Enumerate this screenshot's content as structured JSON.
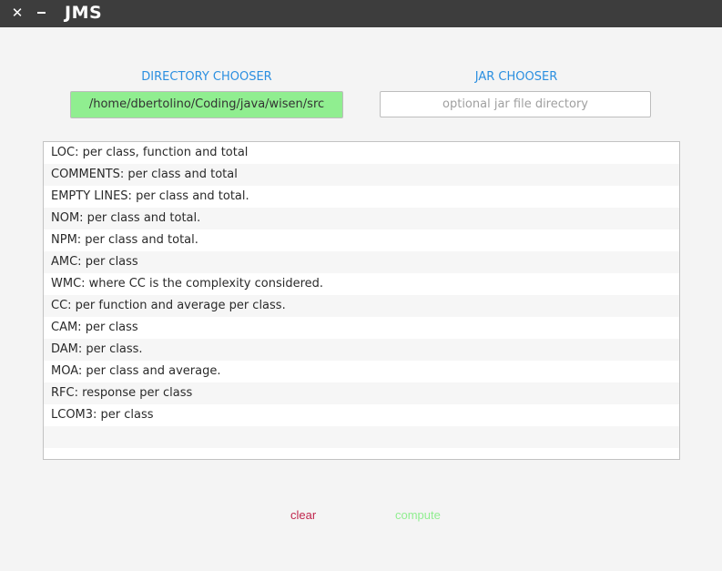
{
  "titlebar": {
    "title": "JMS",
    "close_glyph": "✕",
    "close_icon": "close-icon",
    "minimize_icon": "minimize-icon"
  },
  "directory_chooser": {
    "label": "DIRECTORY CHOOSER",
    "value": "/home/dbertolino/Coding/java/wisen/src",
    "background_color": "#90ee90"
  },
  "jar_chooser": {
    "label": "JAR CHOOSER",
    "placeholder": "optional jar file directory",
    "value": ""
  },
  "metrics_list": {
    "items": [
      "LOC: per class, function and total",
      "COMMENTS: per class and total",
      "EMPTY LINES: per class and total.",
      "NOM: per class and total.",
      "NPM: per class and total.",
      "AMC: per class",
      "WMC: where CC is the complexity considered.",
      "CC: per function and average per class.",
      "CAM: per class",
      "DAM: per class.",
      "MOA: per class and average.",
      "RFC: response per class",
      "LCOM3: per class"
    ]
  },
  "actions": {
    "clear_label": "clear",
    "compute_label": "compute"
  },
  "colors": {
    "accent_blue": "#2b8fe0",
    "clear_red": "#c0264d",
    "compute_green": "#90ee90",
    "titlebar_bg": "#3d3d3d"
  }
}
